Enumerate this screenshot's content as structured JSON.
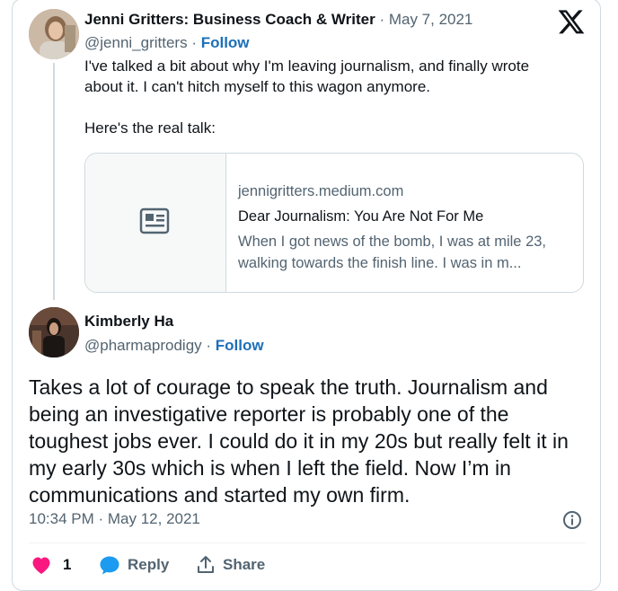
{
  "original_tweet": {
    "author_name": "Jenni Gritters: Business Coach & Writer",
    "date": " · May 7, 2021",
    "handle": "@jenni_gritters",
    "separator": " · ",
    "follow_label": "Follow",
    "text_line1": "I've talked a bit about why I'm leaving journalism, and finally wrote about it. I can't hitch myself to this wagon anymore.",
    "text_line2": "Here's the real talk:",
    "link_card": {
      "domain": "jennigritters.medium.com",
      "title": "Dear Journalism: You Are Not For Me",
      "description": "When I got news of the bomb, I was at mile 23, walking towards the finish line. I was in m..."
    }
  },
  "reply_tweet": {
    "author_name": "Kimberly Ha",
    "handle": "@pharmaprodigy",
    "separator": " · ",
    "follow_label": "Follow",
    "text": "Takes a lot of courage to speak the truth. Journalism and being an investigative reporter is probably one of the toughest jobs ever. I could do it in my 20s but really felt it in my early 30s which is when I left the field. Now I’m in communications and started my own firm.",
    "timestamp": "10:34 PM · May 12, 2021",
    "like_count": "1",
    "reply_label": "Reply",
    "share_label": "Share"
  },
  "colors": {
    "accent": "#1d6fb8",
    "like": "#f91880",
    "muted": "#536471",
    "border": "#cfd9de"
  },
  "icons": [
    "x-logo-icon",
    "newspaper-icon",
    "info-icon",
    "heart-icon",
    "reply-bubble-icon",
    "share-icon"
  ]
}
